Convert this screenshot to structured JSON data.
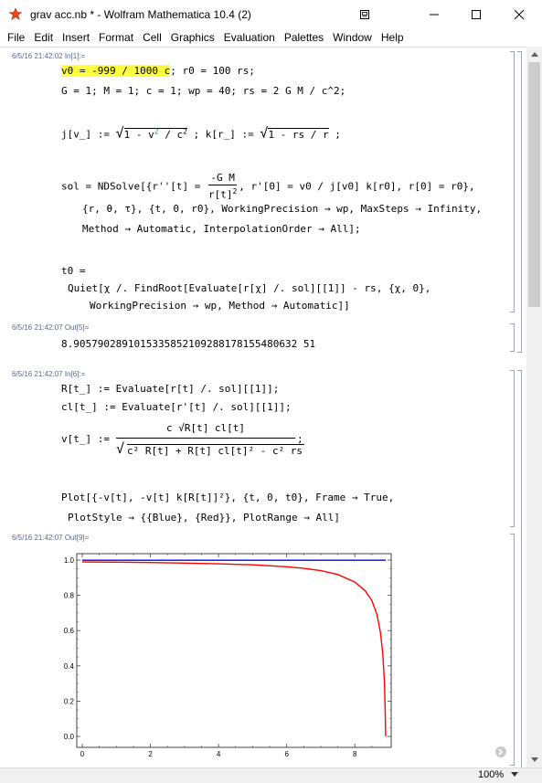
{
  "window": {
    "title": "grav acc.nb * - Wolfram Mathematica 10.4 (2)"
  },
  "menu": [
    "File",
    "Edit",
    "Insert",
    "Format",
    "Cell",
    "Graphics",
    "Evaluation",
    "Palettes",
    "Window",
    "Help"
  ],
  "cells": {
    "in1_label": "6/5/16 21:42:02 In[1]:=",
    "in1_line1_highlight": "v0 = -999 / 1000 c",
    "in1_line1_rest": "; r0 = 100 rs;",
    "in1_line2": "G = 1; M = 1; c = 1; wp = 40; rs = 2 G M / c^2;",
    "in1_line3_a": "j[v_] := ",
    "in1_line3_b": "1 - v",
    "in1_line3_c": "2",
    "in1_line3_d": " / c",
    "in1_line3_e": "2",
    "in1_line3_f": " ; k[r_] := ",
    "in1_line3_g": "1 - rs / r",
    "in1_line3_h": " ;",
    "in1_sol_a": "sol = NDSolve[{r''[t] = ",
    "in1_sol_num": "-G M",
    "in1_sol_den": "r[t]",
    "in1_sol_den_exp": "2",
    "in1_sol_b": ", r'[0] = v0 / j[v0] k[r0], r[0] = r0},",
    "in1_sol_line2": "{r, θ, τ}, {t, 0, r0}, WorkingPrecision → wp, MaxSteps → Infinity,",
    "in1_sol_line3": "Method → Automatic, InterpolationOrder → All];",
    "in1_t0_line1": "t0 =",
    "in1_t0_line2": "Quiet[χ /. FindRoot[Evaluate[r[χ] /. sol][[1]] - rs, {χ, 0},",
    "in1_t0_line3": "WorkingPrecision → wp, Method → Automatic]]",
    "out5_label": "6/5/16 21:42:07 Out[5]=",
    "out5_value": "8.9057902891015335852109288178155480632 51",
    "in6_label": "6/5/16 21:42:07 In[6]:=",
    "in6_line1": "R[t_] := Evaluate[r[t] /. sol][[1]];",
    "in6_line2": "cl[t_] := Evaluate[r'[t] /. sol][[1]];",
    "in6_v_lhs": "v[t_] :=",
    "in6_v_num": "c √R[t] cl[t]",
    "in6_v_den": "c² R[t] + R[t] cl[t]² - c² rs",
    "in6_plot_line1": "Plot[{-v[t], -v[t] k[R[t]]²}, {t, 0, t0}, Frame → True,",
    "in6_plot_line2": "PlotStyle → {{Blue}, {Red}}, PlotRange → All]",
    "out9_label": "6/5/16 21:42:07 Out[9]="
  },
  "chart_data": {
    "type": "line",
    "xlim": [
      0,
      8.9058
    ],
    "ylim": [
      0,
      1.0
    ],
    "x_ticks": [
      "0",
      "2",
      "4",
      "6",
      "8"
    ],
    "y_ticks": [
      "0.0",
      "0.2",
      "0.4",
      "0.6",
      "0.8",
      "1.0"
    ],
    "series": [
      {
        "color": "#0000ff",
        "x": [
          0,
          8.9058
        ],
        "y": [
          0.999,
          0.999
        ]
      },
      {
        "color": "#ff0000",
        "x": [
          0,
          1,
          2,
          3,
          4,
          5,
          6,
          6.5,
          7,
          7.5,
          8,
          8.3,
          8.5,
          8.65,
          8.75,
          8.82,
          8.87,
          8.89,
          8.9058
        ],
        "y": [
          0.989,
          0.988,
          0.986,
          0.983,
          0.979,
          0.973,
          0.962,
          0.953,
          0.94,
          0.918,
          0.875,
          0.827,
          0.77,
          0.69,
          0.59,
          0.47,
          0.3,
          0.15,
          0.0
        ]
      }
    ]
  },
  "status": {
    "zoom": "100%"
  },
  "colors": {
    "label": "#5a6a8c",
    "highlight": "#ffff40",
    "blue_line": "#0000ff",
    "red_line": "#ff0000"
  }
}
